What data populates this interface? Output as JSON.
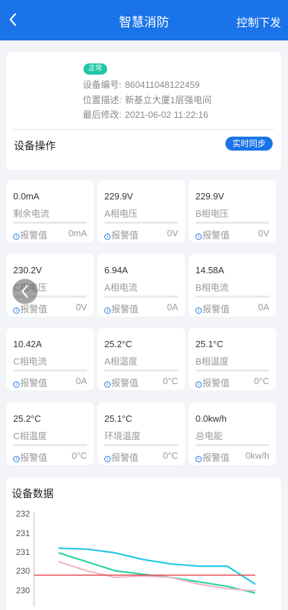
{
  "header": {
    "title": "智慧消防",
    "action_label": "控制下发",
    "back_icon": "chevron-left-icon"
  },
  "device": {
    "status_badge": "正常",
    "rows": [
      {
        "label": "设备编号:",
        "value": "860411048122459"
      },
      {
        "label": "位置描述:",
        "value": "新基立大厦1层强电间"
      },
      {
        "label": "最后修改:",
        "value": "2021-06-02 11:22:16"
      }
    ],
    "ops_label": "设备操作",
    "sync_label": "实时同步"
  },
  "metrics": [
    {
      "value": "0.0mA",
      "name": "剩余电流",
      "alarm_label": "报警值",
      "limit": "0mA"
    },
    {
      "value": "229.9V",
      "name": "A相电压",
      "alarm_label": "报警值",
      "limit": "0V"
    },
    {
      "value": "229.9V",
      "name": "B相电压",
      "alarm_label": "报警值",
      "limit": "0V"
    },
    {
      "value": "230.2V",
      "name": "C相电压",
      "alarm_label": "报警值",
      "limit": "0V"
    },
    {
      "value": "6.94A",
      "name": "A相电流",
      "alarm_label": "报警值",
      "limit": "0A"
    },
    {
      "value": "14.58A",
      "name": "B相电流",
      "alarm_label": "报警值",
      "limit": "0A"
    },
    {
      "value": "10.42A",
      "name": "C相电流",
      "alarm_label": "报警值",
      "limit": "0A"
    },
    {
      "value": "25.2°C",
      "name": "A相温度",
      "alarm_label": "报警值",
      "limit": "0°C"
    },
    {
      "value": "25.1°C",
      "name": "B相温度",
      "alarm_label": "报警值",
      "limit": "0°C"
    },
    {
      "value": "25.2°C",
      "name": "C相温度",
      "alarm_label": "报警值",
      "limit": "0°C"
    },
    {
      "value": "25.1°C",
      "name": "环境温度",
      "alarm_label": "报警值",
      "limit": "0°C"
    },
    {
      "value": "0.0kw/h",
      "name": "总电能",
      "alarm_label": "报警值",
      "limit": "0kw/h"
    }
  ],
  "chart_data": {
    "type": "line",
    "title": "设备数据",
    "y_tick_labels": [
      "232",
      "231",
      "231",
      "230",
      "230"
    ],
    "ylim": [
      229.9,
      232
    ],
    "grid": false,
    "legend": "none",
    "x": [
      0,
      1,
      2,
      3,
      4,
      5,
      6,
      7
    ],
    "series": [
      {
        "color": "#1fc6e8",
        "values": [
          231.2,
          231.18,
          231.1,
          230.95,
          230.85,
          230.8,
          230.8,
          230.4
        ]
      },
      {
        "color": "#23d3a0",
        "values": [
          231.1,
          230.9,
          230.7,
          230.62,
          230.55,
          230.45,
          230.35,
          230.2
        ]
      },
      {
        "color": "#f4b6c2",
        "values": [
          230.9,
          230.7,
          230.55,
          230.58,
          230.55,
          230.4,
          230.3,
          230.25
        ]
      },
      {
        "color": "#e0474c",
        "values": [
          230.6,
          230.6,
          230.6,
          230.6,
          230.6,
          230.6,
          230.6,
          230.6
        ]
      }
    ]
  }
}
